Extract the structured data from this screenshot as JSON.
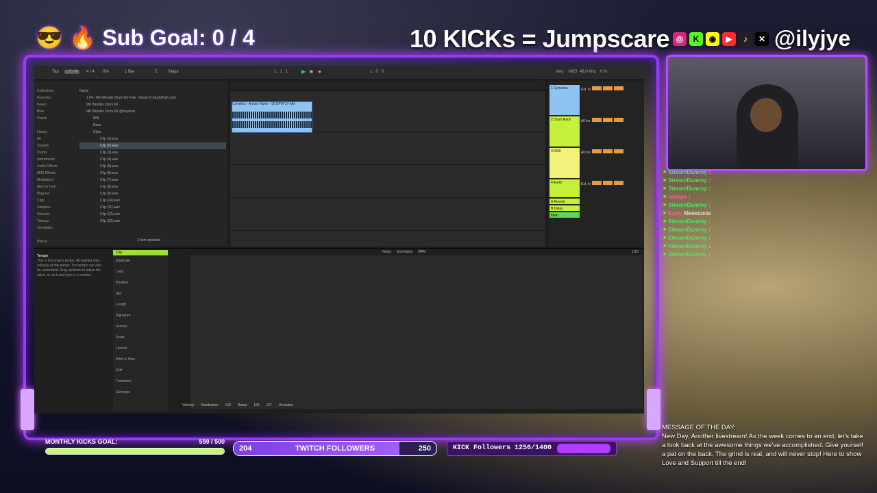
{
  "overlay": {
    "sub_goal": "Sub Goal: 0 / 4",
    "jumpscare": "10 KICKs = Jumpscare",
    "handle": "@ilyjye",
    "social_icons": [
      "instagram-icon",
      "kick-icon",
      "snapchat-icon",
      "youtube-icon",
      "tiktok-icon",
      "x-icon"
    ]
  },
  "daw": {
    "topbar": [
      "Tap",
      "120.00",
      "4 / 4",
      "0%",
      "1 Bar",
      "C",
      "Major",
      "1 . 1 . 1",
      "1 . 0 . 0",
      "Key",
      "MIDI",
      "48.0 kHz",
      "0 %"
    ],
    "collections": [
      "Collections",
      "Favorites",
      "Green",
      "Blue",
      "Purple",
      "",
      "Library",
      "All",
      "Sounds",
      "Drums",
      "Instruments",
      "Audio Effects",
      "MIDI Effects",
      "Modulators",
      "Max for Live",
      "Plug-Ins",
      "Clips",
      "Samples",
      "Grooves",
      "Tunings",
      "Templates",
      "",
      "Places"
    ],
    "files_header": "Name",
    "files": [
      "1.04 - 9th Wonder Drum Kit Free - (www.FLStudioFull.com)",
      "9th Wonder Drum Kit",
      "9th Wonder Drum Kit @daywink",
      "808",
      "Bass",
      "Clips",
      "Clip (1).wav",
      "Clip (2).wav",
      "Clip (3).wav",
      "Clip (4).wav",
      "Clip (5).wav",
      "Clip (6).wav",
      "Clip (7).wav",
      "Clip (8).wav",
      "Clip (9).wav",
      "Clip (10).wav",
      "Clip (11).wav",
      "Clip (12).wav",
      "Clip (13).wav"
    ],
    "selected_file_index": 7,
    "items_selected": "1 item selected",
    "clip_name": "Cortellos - Amber Rules - 95 BPM C# Min",
    "tracks": [
      {
        "name": "1 Cymatics",
        "color": "#8ec3f2"
      },
      {
        "name": "2 Drum Rack",
        "color": "#c7f03a"
      },
      {
        "name": "3 MIDI",
        "color": "#f2f27a"
      },
      {
        "name": "4 Audio",
        "color": "#c7f03a"
      },
      {
        "name": "A Reverb",
        "color": "#c7f03a"
      },
      {
        "name": "B Delay",
        "color": "#c7f03a"
      },
      {
        "name": "Main",
        "color": "#5ed65e"
      }
    ],
    "detail_info": "This is the project tempo. All warped clips will play at this tempo. The tempo can also be automated. Drag up/down to adjust the value, or click and type in a number.",
    "detail_title": "Tempo",
    "clip_panel": [
      "Clip",
      "Duplicate",
      "Loop",
      "Position",
      "Set",
      "Length",
      "Signature",
      "Groove",
      "Scale",
      "Launch",
      "Pitch & Time",
      "Grid",
      "Transform",
      "Generate"
    ],
    "editor_tabs": [
      "Notes",
      "Envelopes",
      "MPE"
    ],
    "editor_bottom": [
      "Velocity",
      "Randomize",
      "100",
      "Ramp",
      "180",
      "127",
      "Deviation"
    ],
    "grid_value": "1/16",
    "mixer_in_labels": [
      "Ext. In",
      "All Ins",
      "All Ins",
      "Ext. In"
    ]
  },
  "chat": [
    {
      "user": "StreamDummy",
      "msg": ":"
    },
    {
      "user": "StreamDummy",
      "msg": ":"
    },
    {
      "user": "StreamDummy",
      "msg": ":"
    },
    {
      "user": "cwlope",
      "msg": ":"
    },
    {
      "user": "StreamDummy",
      "msg": ":"
    },
    {
      "user": "Ezzle",
      "msg": "Meeeooow"
    },
    {
      "user": "StreamDummy",
      "msg": ":"
    },
    {
      "user": "StreamDummy",
      "msg": ":"
    },
    {
      "user": "StreamDummy",
      "msg": ":"
    },
    {
      "user": "StreamDummy",
      "msg": ":"
    },
    {
      "user": "StreamDummy",
      "msg": ":"
    }
  ],
  "bottom": {
    "monthly_label": "MONTHLY KICKS GOAL:",
    "monthly_value": "559 / 500",
    "monthly_fraction": 1.0,
    "twitch_current": "204",
    "twitch_label": "TWITCH FOLLOWERS",
    "twitch_goal": "250",
    "twitch_fraction": 0.816,
    "kick_label": "KICK Followers 1256/1400",
    "kick_fraction": 0.897
  },
  "motd": {
    "title": "MESSAGE OF THE DAY:",
    "text": "New Day, Another livestream! As the week comes to an end, let's take a look back at the awesome things we've accomplished. Give yourself a pat on the back. The grind is real, and will never stop! Here to show Love and Support till the end!"
  }
}
